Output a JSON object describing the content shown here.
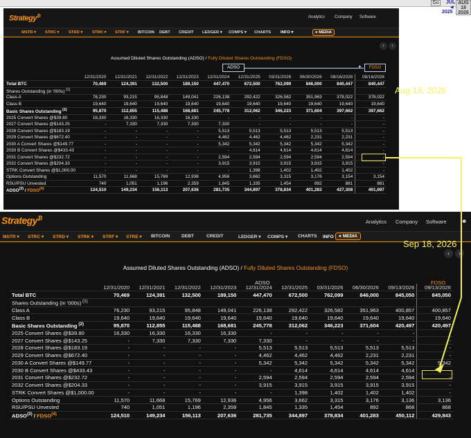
{
  "browser": {
    "go_label": "Go",
    "cal_month": "JUL",
    "cal_day_label": "AUG\n18\n2026",
    "cal_year": "2025",
    "cal_prev": "◀"
  },
  "colors": {
    "accent": "#f7931a",
    "annotation": "#f6f25f",
    "background": "#111111"
  },
  "brand": {
    "name": "Strategy",
    "sup": "₿"
  },
  "top_links": [
    "Analytics",
    "Company",
    "Software"
  ],
  "nav": {
    "items": [
      "MSTR",
      "STRC",
      "STRD",
      "STRK",
      "STRF",
      "STRE",
      "BITCOIN",
      "DEBT",
      "CREDIT",
      "LEDGER",
      "COMPS",
      "CHARTS",
      "INFO"
    ],
    "items_old": [
      "MSTR",
      "STRC",
      "STRD",
      "STRK",
      "STRF",
      "BITCOIN",
      "DEBT",
      "CREDIT",
      "LEDGER",
      "COMPS",
      "CHARTS",
      "INFO"
    ],
    "media": "MEDIA"
  },
  "title": {
    "adso": "Assumed Diluted Shares Outstanding (ADSO)",
    "sep": " / ",
    "fdso": "Fully Diluted Shares Outstanding (FDSO)"
  },
  "annotations": {
    "top_date": "Aug 18, 2026",
    "bottom_date": "Sep 18, 2026"
  },
  "snapshot_aug": {
    "adso_label": "ADSO",
    "fdso_label": "FDSO",
    "dates": [
      "12/31/2020",
      "12/31/2021",
      "12/31/2022",
      "12/31/2023",
      "12/31/2024",
      "12/31/2025",
      "03/31/2026",
      "06/30/2026",
      "08/16/2026",
      "08/16/2026"
    ],
    "rows": [
      {
        "label": "Total BTC",
        "values": [
          "70,469",
          "124,391",
          "132,500",
          "189,150",
          "447,470",
          "672,500",
          "762,099",
          "846,000",
          "840,447",
          "840,447"
        ],
        "bold": true
      },
      {
        "label": "Shares Outstanding (in '000s)",
        "sup": "(1)",
        "values": []
      },
      {
        "label": "Class A",
        "values": [
          "76,230",
          "93,215",
          "95,848",
          "149,041",
          "226,138",
          "292,422",
          "326,582",
          "351,963",
          "378,022",
          "378,022"
        ]
      },
      {
        "label": "Class B",
        "values": [
          "19,640",
          "19,640",
          "19,640",
          "19,640",
          "19,640",
          "19,640",
          "19,640",
          "19,640",
          "19,640",
          "19,640"
        ]
      },
      {
        "label": "Basic Shares Outstanding",
        "sup": "(2)",
        "values": [
          "95,870",
          "112,855",
          "115,488",
          "168,681",
          "245,778",
          "312,062",
          "346,223",
          "371,604",
          "397,662",
          "397,662"
        ],
        "bold": true
      },
      {
        "label": "2025 Convert Shares @$39.80",
        "values": [
          "16,330",
          "16,330",
          "16,330",
          "16,330",
          "-",
          "-",
          "-",
          "-",
          "-",
          "-"
        ]
      },
      {
        "label": "2027 Convert Shares @$143.25",
        "values": [
          "-",
          "7,330",
          "7,330",
          "7,330",
          "7,330",
          "-",
          "-",
          "-",
          "-",
          "-"
        ]
      },
      {
        "label": "2028 Convert Shares @$183.19",
        "values": [
          "-",
          "-",
          "-",
          "-",
          "5,513",
          "5,513",
          "5,513",
          "5,513",
          "5,513",
          "-"
        ]
      },
      {
        "label": "2029 Convert Shares @$672.40",
        "values": [
          "-",
          "-",
          "-",
          "-",
          "4,462",
          "4,462",
          "4,462",
          "2,231",
          "2,231",
          "-"
        ]
      },
      {
        "label": "2030 A Convert Shares @$149.77",
        "values": [
          "-",
          "-",
          "-",
          "-",
          "5,342",
          "5,342",
          "5,342",
          "5,342",
          "5,342",
          "-"
        ]
      },
      {
        "label": "2030 B Convert Shares @$433.43",
        "values": [
          "-",
          "-",
          "-",
          "-",
          "-",
          "4,614",
          "4,614",
          "4,614",
          "4,614",
          "-"
        ]
      },
      {
        "label": "2031 Convert Shares @$232.72",
        "values": [
          "-",
          "-",
          "-",
          "-",
          "2,594",
          "2,594",
          "2,594",
          "2,594",
          "2,594",
          "-"
        ]
      },
      {
        "label": "2032 Convert Shares @$204.33",
        "values": [
          "-",
          "-",
          "-",
          "-",
          "3,915",
          "3,915",
          "3,915",
          "3,915",
          "3,915",
          "-"
        ]
      },
      {
        "label": "STRK Convert Shares @$1,000.00",
        "values": [
          "-",
          "-",
          "-",
          "-",
          "-",
          "1,398",
          "1,402",
          "1,402",
          "1,402",
          "-"
        ]
      },
      {
        "label": "Options Outstanding",
        "values": [
          "11,570",
          "11,668",
          "15,769",
          "12,936",
          "4,956",
          "3,662",
          "3,315",
          "3,176",
          "3,154",
          "3,154"
        ]
      },
      {
        "label": "RSU/PSU Unvested",
        "values": [
          "740",
          "1,051",
          "1,196",
          "2,359",
          "1,845",
          "1,335",
          "1,454",
          "892",
          "881",
          "881"
        ]
      },
      {
        "label": "ADSO",
        "sup": "(3)",
        "label2": "FDSO",
        "sup2": "(4)",
        "values": [
          "124,510",
          "149,234",
          "156,113",
          "207,636",
          "281,735",
          "344,897",
          "378,834",
          "401,283",
          "427,308",
          "401,697"
        ],
        "bold": true
      }
    ]
  },
  "snapshot_sep": {
    "adso_label": "ADSO",
    "fdso_label": "FDSO",
    "dates": [
      "12/31/2020",
      "12/31/2021",
      "12/31/2022",
      "12/31/2023",
      "12/31/2024",
      "12/31/2025",
      "03/31/2026",
      "06/30/2026",
      "09/13/2026",
      "09/13/2026"
    ],
    "rows": [
      {
        "label": "Total BTC",
        "values": [
          "70,469",
          "124,391",
          "132,500",
          "189,150",
          "447,470",
          "672,500",
          "762,099",
          "846,000",
          "845,050",
          "845,050"
        ],
        "bold": true
      },
      {
        "label": "Shares Outstanding (in '000s)",
        "sup": "(1)",
        "values": []
      },
      {
        "label": "Class A",
        "values": [
          "76,230",
          "93,215",
          "95,848",
          "149,041",
          "226,138",
          "292,422",
          "326,582",
          "351,963",
          "400,857",
          "400,857"
        ]
      },
      {
        "label": "Class B",
        "values": [
          "19,640",
          "19,640",
          "19,640",
          "19,640",
          "19,640",
          "19,640",
          "19,640",
          "19,640",
          "19,640",
          "19,640"
        ]
      },
      {
        "label": "Basic Shares Outstanding",
        "sup": "(2)",
        "values": [
          "95,870",
          "112,855",
          "115,488",
          "168,681",
          "245,778",
          "312,062",
          "346,223",
          "371,604",
          "420,497",
          "420,497"
        ],
        "bold": true
      },
      {
        "label": "2025 Convert Shares @$39.80",
        "values": [
          "16,330",
          "16,330",
          "16,330",
          "16,330",
          "-",
          "-",
          "-",
          "-",
          "-",
          "-"
        ]
      },
      {
        "label": "2027 Convert Shares @$143.25",
        "values": [
          "-",
          "7,330",
          "7,330",
          "7,330",
          "7,330",
          "-",
          "-",
          "-",
          "-",
          "-"
        ]
      },
      {
        "label": "2028 Convert Shares @$183.19",
        "values": [
          "-",
          "-",
          "-",
          "-",
          "5,513",
          "5,513",
          "5,513",
          "5,513",
          "5,513",
          "-"
        ]
      },
      {
        "label": "2029 Convert Shares @$672.40",
        "values": [
          "-",
          "-",
          "-",
          "-",
          "4,462",
          "4,462",
          "4,462",
          "2,231",
          "2,231",
          "-"
        ]
      },
      {
        "label": "2030 A Convert Shares @$149.77",
        "values": [
          "-",
          "-",
          "-",
          "-",
          "5,342",
          "5,342",
          "5,342",
          "5,342",
          "5,342",
          "5,342"
        ]
      },
      {
        "label": "2030 B Convert Shares @$433.43",
        "values": [
          "-",
          "-",
          "-",
          "-",
          "-",
          "4,614",
          "4,614",
          "4,614",
          "4,614",
          "-"
        ]
      },
      {
        "label": "2031 Convert Shares @$232.72",
        "values": [
          "-",
          "-",
          "-",
          "-",
          "2,594",
          "2,594",
          "2,594",
          "2,594",
          "2,594",
          "-"
        ]
      },
      {
        "label": "2032 Convert Shares @$204.33",
        "values": [
          "-",
          "-",
          "-",
          "-",
          "3,915",
          "3,915",
          "3,915",
          "3,915",
          "3,915",
          "-"
        ]
      },
      {
        "label": "STRK Convert Shares @$1,000.00",
        "values": [
          "-",
          "-",
          "-",
          "-",
          "-",
          "1,398",
          "1,402",
          "1,402",
          "1,402",
          "-"
        ]
      },
      {
        "label": "Options Outstanding",
        "values": [
          "11,570",
          "11,668",
          "15,769",
          "12,936",
          "4,956",
          "3,662",
          "3,315",
          "3,176",
          "3,136",
          "3,136"
        ]
      },
      {
        "label": "RSU/PSU Unvested",
        "values": [
          "740",
          "1,051",
          "1,196",
          "2,359",
          "1,845",
          "1,335",
          "1,454",
          "892",
          "868",
          "868"
        ]
      },
      {
        "label": "ADSO",
        "sup": "(3)",
        "label2": "FDSO",
        "sup2": "(4)",
        "values": [
          "124,510",
          "149,234",
          "156,113",
          "207,636",
          "281,735",
          "344,897",
          "378,834",
          "401,283",
          "450,112",
          "429,843"
        ],
        "bold": true
      }
    ]
  }
}
